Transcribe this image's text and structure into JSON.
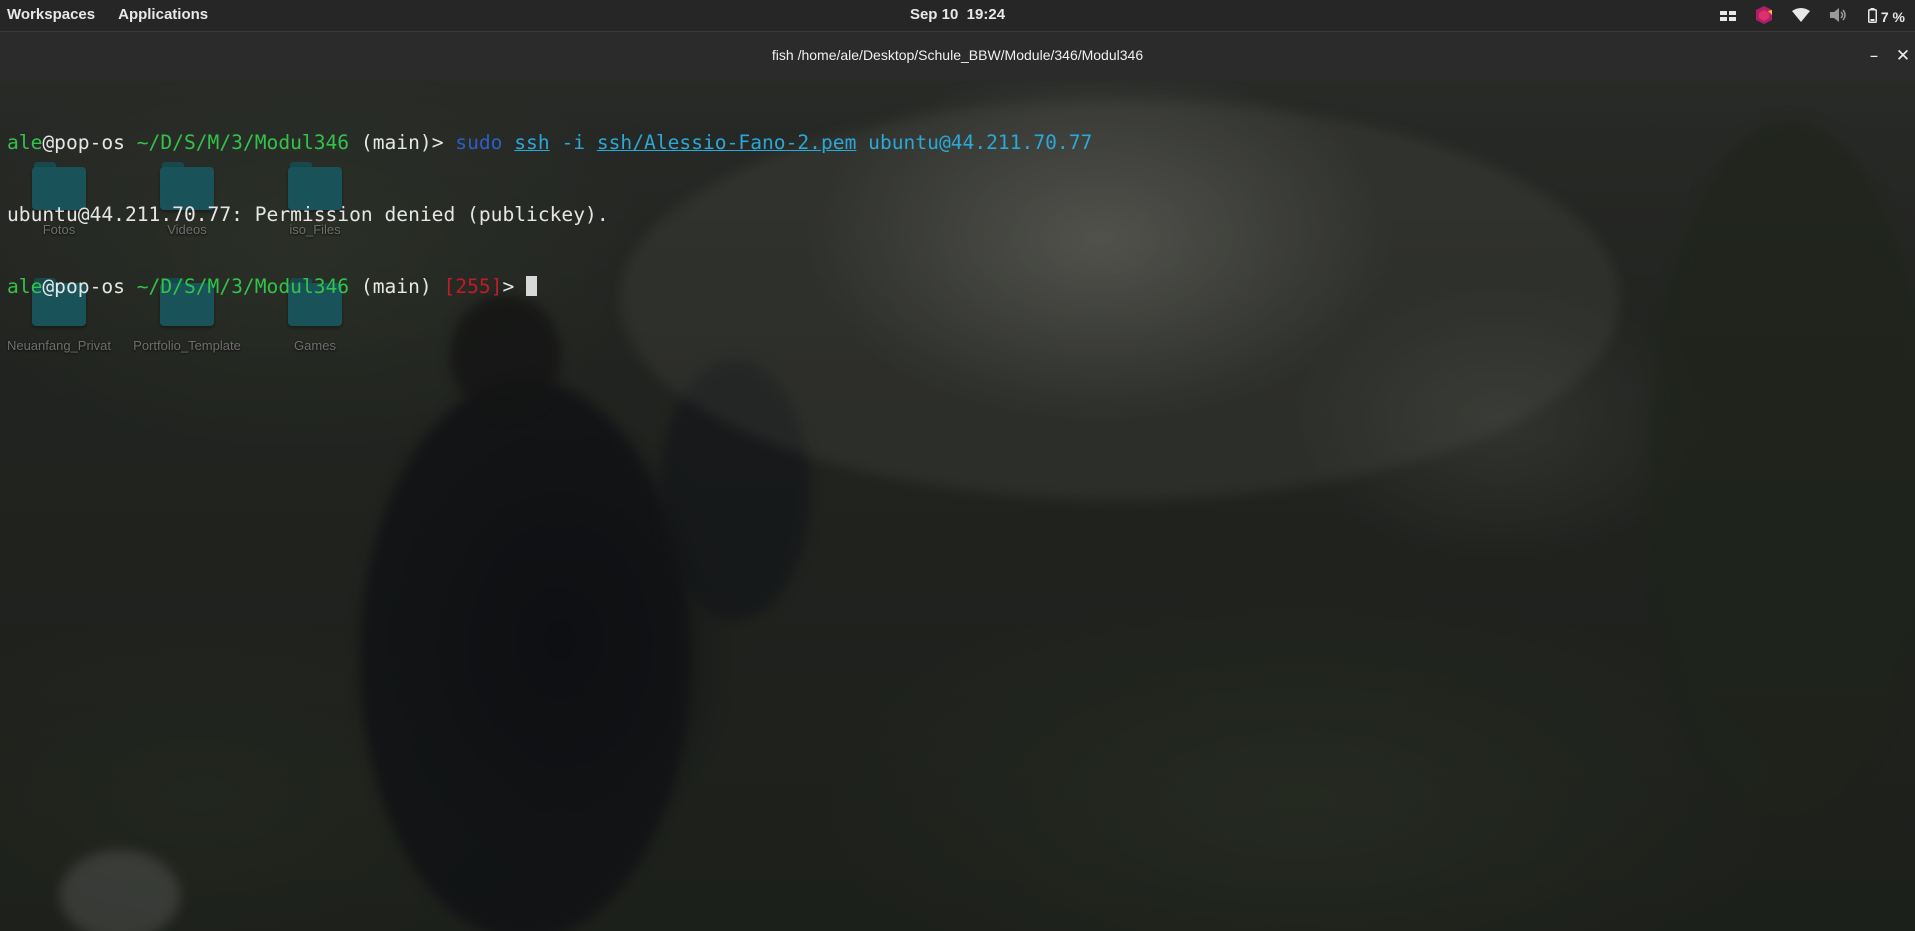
{
  "topbar": {
    "workspaces": "Workspaces",
    "applications": "Applications",
    "date": "Sep 10",
    "time": "19:24",
    "battery_percent": "7 %",
    "tray_icons": [
      "window-switcher-icon",
      "app-indicator-icon",
      "wifi-icon",
      "volume-muted-icon",
      "battery-icon"
    ]
  },
  "terminal": {
    "title": "fish /home/ale/Desktop/Schule_BBW/Module/346/Modul346",
    "minimize_label": "–",
    "close_label": "✕",
    "line1": {
      "user": "ale",
      "host": "@pop-os",
      "path": "~/D/S/M/3/Modul346",
      "branch": "(main)",
      "prompt": ">",
      "cmd_sudo": "sudo",
      "cmd_ssh": "ssh",
      "cmd_flag": "-i",
      "cmd_keyfile": "ssh/Alessio-Fano-2.pem",
      "cmd_target": "ubuntu@44.211.70.77"
    },
    "line2": "ubuntu@44.211.70.77: Permission denied (publickey).",
    "line3": {
      "user": "ale",
      "host": "@pop-os",
      "path": "~/D/S/M/3/Modul346",
      "branch": "(main)",
      "status": "[255]",
      "prompt": ">"
    }
  },
  "desktop_icons": [
    {
      "label": "Fotos"
    },
    {
      "label": "Videos"
    },
    {
      "label": "iso_Files"
    },
    {
      "label": "Neuanfang_Privat"
    },
    {
      "label": "Portfolio_Template"
    },
    {
      "label": "Games"
    }
  ],
  "colors": {
    "prompt_green": "#33c24a",
    "command_blue": "#2b5fc7",
    "argument_cyan": "#2aa8d8",
    "error_red": "#c01c28",
    "folder_teal": "#1f7c86"
  }
}
